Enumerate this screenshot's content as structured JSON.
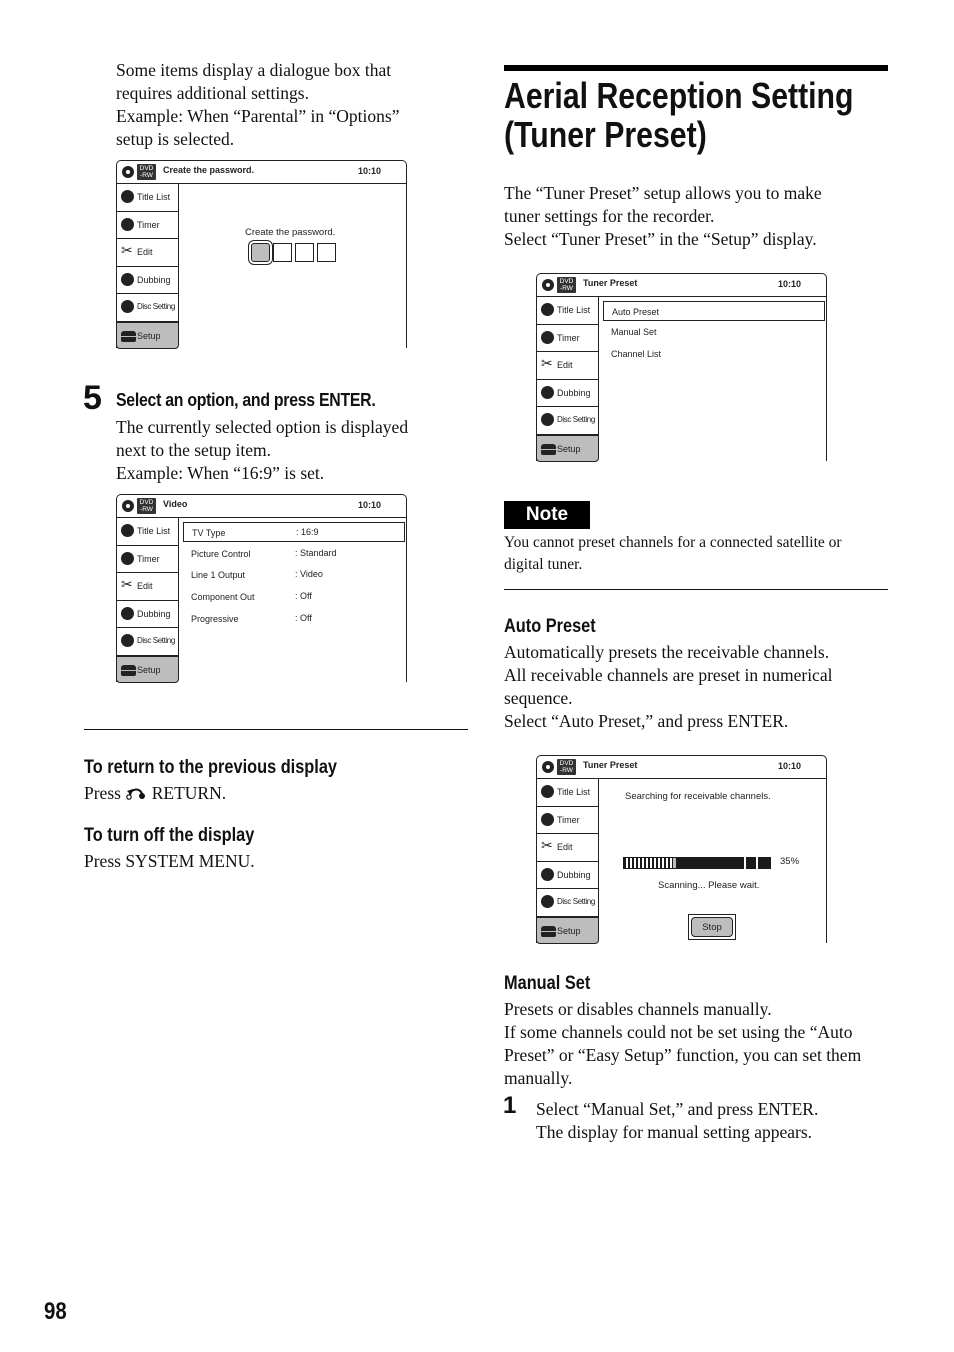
{
  "left": {
    "intro": [
      "Some items display a dialogue box that",
      "requires additional settings.",
      "Example: When “Parental” in “Options”",
      "setup is selected."
    ],
    "step5": {
      "number": "5",
      "title": "Select an option, and press ENTER.",
      "lines": [
        "The currently selected option is displayed",
        "next to the setup item.",
        "Example: When “16:9” is set."
      ]
    },
    "return_section": {
      "heading": "To return to the previous display",
      "text_prefix": "Press",
      "text_suffix": "RETURN.",
      "icon": "return-icon"
    },
    "display_off_section": {
      "heading": "To turn off the display",
      "text": "Press SYSTEM MENU."
    }
  },
  "right": {
    "heading_line1": "Aerial Reception Setting",
    "heading_line2": "(Tuner Preset)",
    "intro": [
      "The “Tuner Preset” setup allows you to make",
      "tuner settings for the recorder.",
      "Select “Tuner Preset” in the “Setup” display."
    ],
    "note": {
      "badge": "Note",
      "lines": [
        "You cannot preset channels for a connected satellite or",
        "digital tuner."
      ]
    },
    "auto_preset": {
      "heading": "Auto Preset",
      "lines": [
        "Automatically presets the receivable channels.",
        "All receivable channels are preset in numerical",
        "sequence.",
        "Select “Auto Preset,” and press ENTER."
      ]
    },
    "manual_set": {
      "heading": "Manual Set",
      "lines": [
        "Presets or disables channels manually.",
        "If some channels could not be set using the “Auto",
        "Preset” or “Easy Setup” function, you can set them",
        "manually."
      ],
      "step1": {
        "number": "1",
        "lines": [
          "Select “Manual Set,” and press ENTER.",
          "The display for manual setting appears."
        ]
      }
    }
  },
  "osd_common": {
    "dvd_badge_line1": "DVD",
    "dvd_badge_line2": "-RW",
    "clock": "10:10",
    "sidebar": [
      {
        "label": "Title List",
        "icon": "title-list-icon"
      },
      {
        "label": "Timer",
        "icon": "timer-icon"
      },
      {
        "label": "Edit",
        "icon": "edit-scissors-icon"
      },
      {
        "label": "Dubbing",
        "icon": "dubbing-icon"
      },
      {
        "label": "Disc Setting",
        "icon": "disc-setting-icon"
      },
      {
        "label": "Setup",
        "icon": "setup-toolbox-icon",
        "selected": true
      }
    ]
  },
  "osd_password": {
    "title": "Create the password.",
    "prompt": "Create the password.",
    "digit_boxes": 4
  },
  "osd_video": {
    "title": "Video",
    "rows": [
      {
        "key": "TV Type",
        "value": ":  16:9",
        "highlighted": true
      },
      {
        "key": "Picture Control",
        "value": ":  Standard"
      },
      {
        "key": "Line 1 Output",
        "value": ":  Video"
      },
      {
        "key": "Component Out",
        "value": ":  Off"
      },
      {
        "key": "Progressive",
        "value": ":  Off"
      }
    ]
  },
  "osd_tuner_menu": {
    "title": "Tuner Preset",
    "items": [
      {
        "label": "Auto Preset",
        "highlighted": true
      },
      {
        "label": "Manual Set"
      },
      {
        "label": "Channel List"
      }
    ]
  },
  "osd_tuner_scan": {
    "title": "Tuner Preset",
    "message": "Searching for receivable channels.",
    "progress_percent": 35,
    "progress_label": "35%",
    "status": "Scanning... Please wait.",
    "stop_button": "Stop"
  },
  "page_number": "98"
}
